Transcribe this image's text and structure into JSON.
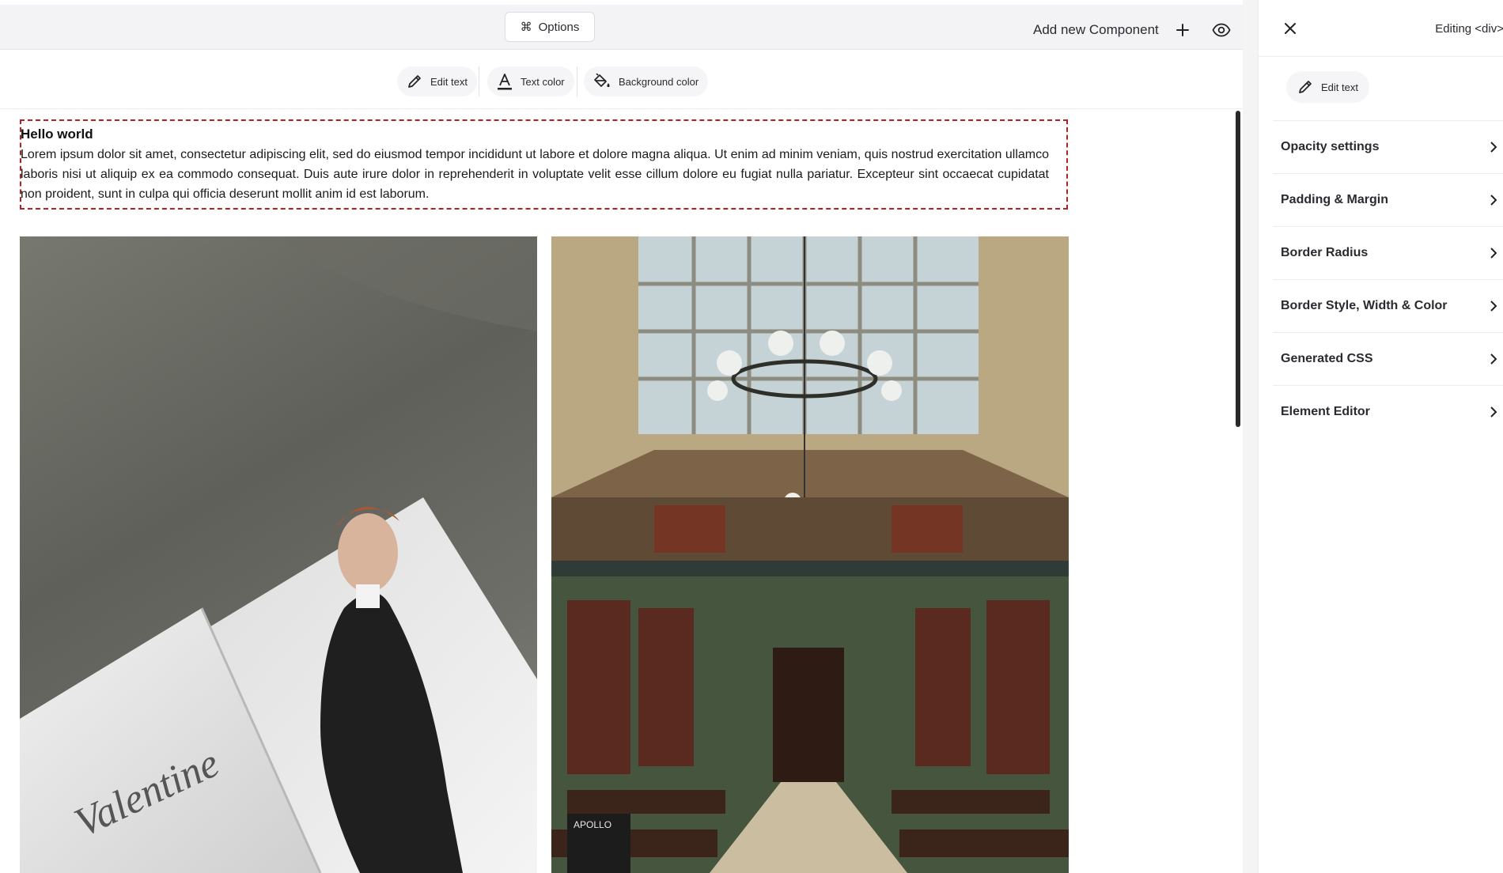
{
  "topbar": {
    "options_label": "Options",
    "options_glyph": "⌘",
    "add_component_label": "Add new Component"
  },
  "toolbar": {
    "edit_text": "Edit text",
    "text_color": "Text color",
    "background_color": "Background color"
  },
  "content": {
    "heading": "Hello world",
    "paragraph": "Lorem ipsum dolor sit amet, consectetur adipiscing elit, sed do eiusmod tempor incididunt ut labore et dolore magna aliqua. Ut enim ad minim veniam, quis nostrud exercitation ullamco laboris nisi ut aliquip ex ea commodo consequat. Duis aute irure dolor in reprehenderit in voluptate velit esse cillum dolore eu fugiat nulla pariatur. Excepteur sint occaecat cupidatat non proident, sunt in culpa qui officia deserunt mollit anim id est laborum.",
    "magazine_text": "Valentine",
    "book_cover_text": "APOLLO"
  },
  "panel": {
    "editing_label": "Editing <div>",
    "edit_text": "Edit text",
    "sections": [
      "Opacity settings",
      "Padding & Margin",
      "Border Radius",
      "Border Style, Width & Color",
      "Generated CSS",
      "Element Editor"
    ]
  },
  "colors": {
    "selection_border": "#b22222",
    "text_primary": "#1f1f23"
  },
  "icons": {
    "options": "command-icon",
    "add": "plus-icon",
    "preview": "eye-icon",
    "edit": "pencil-icon",
    "text_color": "text-color-icon",
    "background": "paint-bucket-icon",
    "close": "close-icon",
    "chevron": "chevron-right-icon"
  }
}
